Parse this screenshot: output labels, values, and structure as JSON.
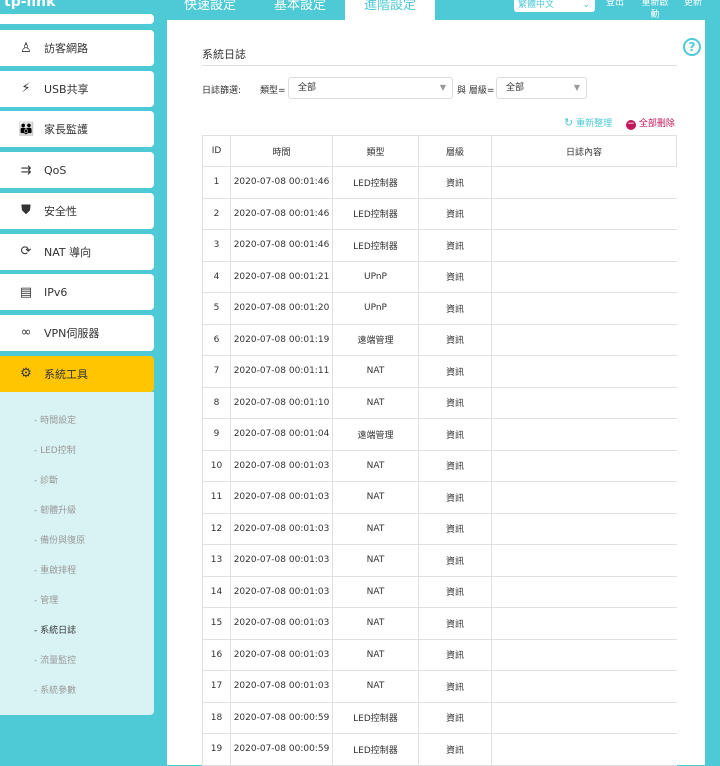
{
  "header": {
    "logo": "tp-link",
    "tabs": [
      "快速設定",
      "基本設定",
      "進階設定"
    ],
    "active_tab": 2,
    "language": "繁體中文",
    "logout": "登出",
    "reboot": "重新啟動",
    "update": "更新"
  },
  "sidebar": {
    "items": [
      {
        "label": "訪客網路",
        "icon": "guest-icon"
      },
      {
        "label": "USB共享",
        "icon": "usb-icon"
      },
      {
        "label": "家長監護",
        "icon": "parental-icon"
      },
      {
        "label": "QoS",
        "icon": "qos-icon"
      },
      {
        "label": "安全性",
        "icon": "shield-icon"
      },
      {
        "label": "NAT 導向",
        "icon": "nat-icon"
      },
      {
        "label": "IPv6",
        "icon": "ipv6-icon"
      },
      {
        "label": "VPN伺服器",
        "icon": "vpn-icon"
      },
      {
        "label": "系統工具",
        "icon": "gear-icon"
      }
    ],
    "sub_items": [
      "時間設定",
      "LED控制",
      "診斷",
      "韌體升級",
      "備份與復原",
      "重啟排程",
      "管理",
      "系統日誌",
      "流量監控",
      "系統參數"
    ],
    "current_sub": 7
  },
  "main": {
    "title": "系統日誌",
    "filter_label": "日誌篩選:",
    "type_label": "類型=",
    "type_value": "全部",
    "and_level_label": "與 層級=",
    "level_value": "全部",
    "refresh": "重新整理",
    "delete_all": "全部刪除",
    "help": "?",
    "columns": [
      "ID",
      "時間",
      "類型",
      "層級",
      "日誌內容"
    ],
    "rows": [
      [
        "1",
        "2020-07-08 00:01:46",
        "LED控制器",
        "資訊",
        ""
      ],
      [
        "2",
        "2020-07-08 00:01:46",
        "LED控制器",
        "資訊",
        ""
      ],
      [
        "3",
        "2020-07-08 00:01:46",
        "LED控制器",
        "資訊",
        ""
      ],
      [
        "4",
        "2020-07-08 00:01:21",
        "UPnP",
        "資訊",
        ""
      ],
      [
        "5",
        "2020-07-08 00:01:20",
        "UPnP",
        "資訊",
        ""
      ],
      [
        "6",
        "2020-07-08 00:01:19",
        "遠端管理",
        "資訊",
        ""
      ],
      [
        "7",
        "2020-07-08 00:01:11",
        "NAT",
        "資訊",
        ""
      ],
      [
        "8",
        "2020-07-08 00:01:10",
        "NAT",
        "資訊",
        ""
      ],
      [
        "9",
        "2020-07-08 00:01:04",
        "遠端管理",
        "資訊",
        ""
      ],
      [
        "10",
        "2020-07-08 00:01:03",
        "NAT",
        "資訊",
        ""
      ],
      [
        "11",
        "2020-07-08 00:01:03",
        "NAT",
        "資訊",
        ""
      ],
      [
        "12",
        "2020-07-08 00:01:03",
        "NAT",
        "資訊",
        ""
      ],
      [
        "13",
        "2020-07-08 00:01:03",
        "NAT",
        "資訊",
        ""
      ],
      [
        "14",
        "2020-07-08 00:01:03",
        "NAT",
        "資訊",
        ""
      ],
      [
        "15",
        "2020-07-08 00:01:03",
        "NAT",
        "資訊",
        ""
      ],
      [
        "16",
        "2020-07-08 00:01:03",
        "NAT",
        "資訊",
        ""
      ],
      [
        "17",
        "2020-07-08 00:01:03",
        "NAT",
        "資訊",
        ""
      ],
      [
        "18",
        "2020-07-08 00:00:59",
        "LED控制器",
        "資訊",
        ""
      ],
      [
        "19",
        "2020-07-08 00:00:59",
        "LED控制器",
        "資訊",
        ""
      ]
    ]
  },
  "colors": {
    "teal": "#4ecad6",
    "yellow": "#ffc600",
    "danger": "#c2185b"
  }
}
